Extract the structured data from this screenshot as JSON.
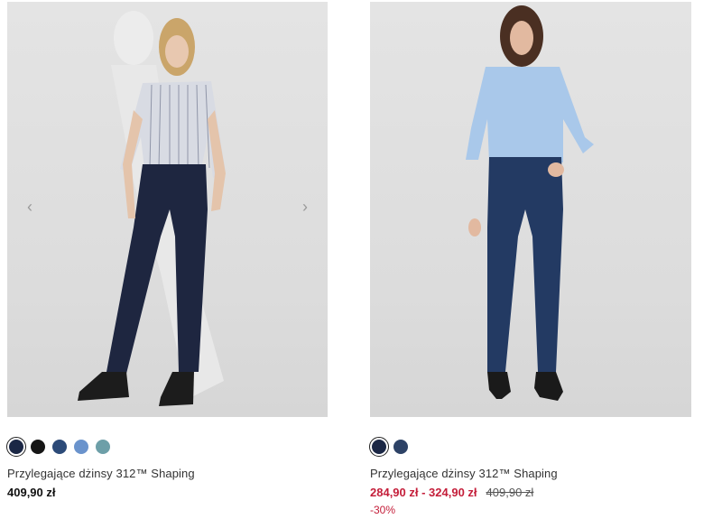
{
  "products": [
    {
      "name": "Przylegające dżinsy 312™ Shaping",
      "price": "409,90 zł",
      "swatches": [
        {
          "color": "#1b2745",
          "selected": true
        },
        {
          "color": "#161616",
          "selected": false
        },
        {
          "color": "#2c4a78",
          "selected": false
        },
        {
          "color": "#6a93cc",
          "selected": false
        },
        {
          "color": "#6d9fa8",
          "selected": false
        }
      ],
      "image_icon": "model-photo-dark-jeans-striped-shirt",
      "has_carousel_arrows": true
    },
    {
      "name": "Przylegające dżinsy 312™ Shaping",
      "price": "284,90 zł - 324,90 zł",
      "old_price": "409,90 zł",
      "discount": "-30%",
      "swatches": [
        {
          "color": "#1b2745",
          "selected": true
        },
        {
          "color": "#2d4266",
          "selected": false
        }
      ],
      "image_icon": "model-photo-blue-jeans-blue-shirt",
      "has_carousel_arrows": false
    }
  ],
  "carousel": {
    "prev_icon": "‹",
    "next_icon": "›"
  },
  "colors": {
    "sale": "#c41e3a",
    "text": "#222222"
  }
}
